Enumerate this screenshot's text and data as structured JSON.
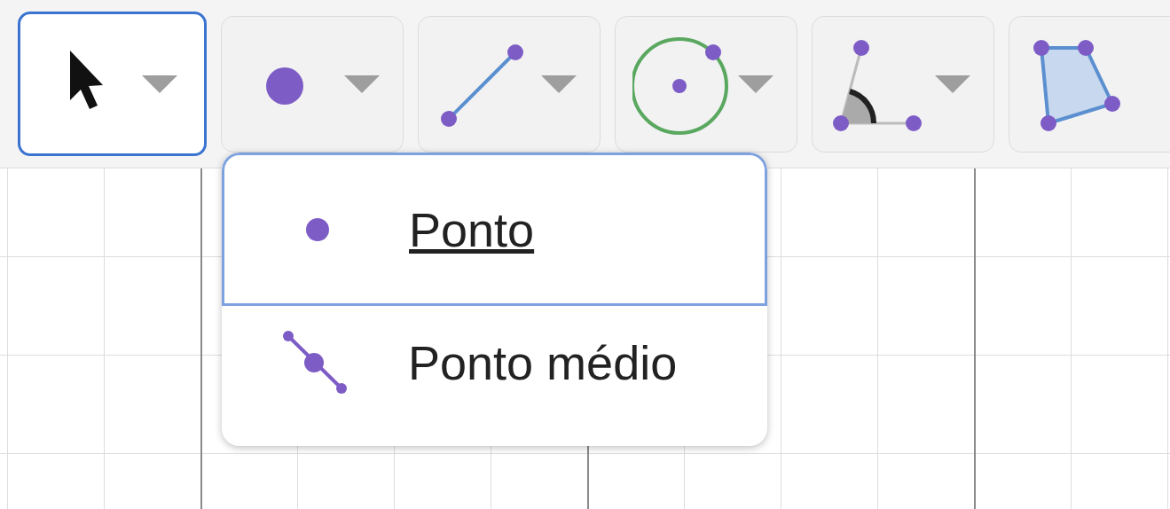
{
  "toolbar": {
    "tools": [
      {
        "kind": "move",
        "selected": true,
        "menu_arrow": true
      },
      {
        "kind": "point",
        "selected": false,
        "menu_arrow": true
      },
      {
        "kind": "segment",
        "selected": false,
        "menu_arrow": true
      },
      {
        "kind": "circle",
        "selected": false,
        "menu_arrow": true
      },
      {
        "kind": "angle",
        "selected": false,
        "menu_arrow": true
      },
      {
        "kind": "polygon",
        "selected": false,
        "menu_arrow": false
      }
    ]
  },
  "menu": {
    "items": [
      {
        "kind": "point",
        "label": "Ponto",
        "selected": true
      },
      {
        "kind": "midpoint",
        "label": "Ponto médio",
        "selected": false
      }
    ]
  }
}
